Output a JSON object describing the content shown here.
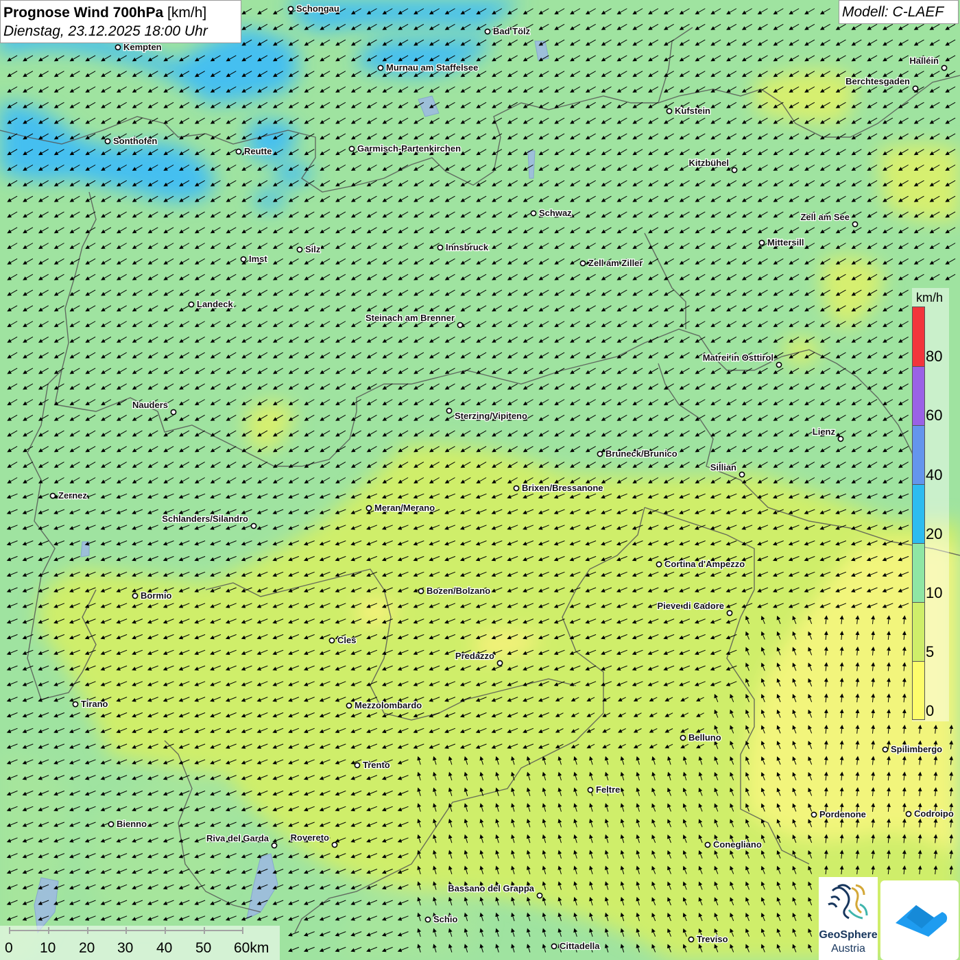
{
  "header": {
    "title_bold": "Prognose Wind 700hPa",
    "title_unit": "[km/h]",
    "datetime": "Dienstag, 23.12.2025 18:00 Uhr",
    "model": "Modell: C-LAEF"
  },
  "legend": {
    "unit": "km/h",
    "labels": [
      "80",
      "60",
      "40",
      "20",
      "10",
      "5",
      "0"
    ],
    "colors": {
      "80_plus": "#f2353b",
      "60_80": "#9a61e6",
      "40_60": "#6495ed",
      "20_40": "#2dbcf0",
      "10_20": "#8fe6a4",
      "5_10": "#cfee6a",
      "0_5": "#fdfc6c"
    }
  },
  "scale_bar": {
    "labels": [
      "0",
      "10",
      "20",
      "30",
      "40",
      "50",
      "60km"
    ]
  },
  "cities": [
    {
      "name": "Schongau"
    },
    {
      "name": "Bad Tölz"
    },
    {
      "name": "Kempten"
    },
    {
      "name": "Murnau am Staffelsee"
    },
    {
      "name": "Halléin"
    },
    {
      "name": "Berchtesgaden"
    },
    {
      "name": "Kufstein"
    },
    {
      "name": "Sonthofen"
    },
    {
      "name": "Reutte"
    },
    {
      "name": "Garmisch-Partenkirchen"
    },
    {
      "name": "Kitzbühel"
    },
    {
      "name": "Schwaz"
    },
    {
      "name": "Zell am See"
    },
    {
      "name": "Mittersill"
    },
    {
      "name": "Innsbruck"
    },
    {
      "name": "Silz"
    },
    {
      "name": "Imst"
    },
    {
      "name": "Zell am Ziller"
    },
    {
      "name": "Landeck"
    },
    {
      "name": "Steinach am Brenner"
    },
    {
      "name": "Matrei in Osttirol"
    },
    {
      "name": "Nauders"
    },
    {
      "name": "Sterzing/Vipiteno"
    },
    {
      "name": "Lienz"
    },
    {
      "name": "Bruneck/Brunico"
    },
    {
      "name": "Sillian"
    },
    {
      "name": "Zernez"
    },
    {
      "name": "Brixen/Bressanone"
    },
    {
      "name": "Meran/Merano"
    },
    {
      "name": "Schlanders/Silandro"
    },
    {
      "name": "Cortina d'Ampezzo"
    },
    {
      "name": "Bormio"
    },
    {
      "name": "Bozen/Bolzano"
    },
    {
      "name": "Pieve di Cadore"
    },
    {
      "name": "Cles"
    },
    {
      "name": "Predazzo"
    },
    {
      "name": "Tirano"
    },
    {
      "name": "Mezzolombardo"
    },
    {
      "name": "Belluno"
    },
    {
      "name": "Spilimbergo"
    },
    {
      "name": "Trento"
    },
    {
      "name": "Feltre"
    },
    {
      "name": "Pordenone"
    },
    {
      "name": "Codroipo"
    },
    {
      "name": "Bienno"
    },
    {
      "name": "Riva del Garda"
    },
    {
      "name": "Rovereto"
    },
    {
      "name": "Conegliano"
    },
    {
      "name": "Bassano del Grappa"
    },
    {
      "name": "Schio"
    },
    {
      "name": "Treviso"
    },
    {
      "name": "Cittadella"
    }
  ],
  "logos": {
    "geosphere_line1": "GeoSphere",
    "geosphere_line2": "Austria",
    "geosphere_icon": "geosphere-logo-icon",
    "app_icon": "wetter-app-icon"
  },
  "wind_field": {
    "dominant_direction": "from north-east",
    "south_east_direction": "from south"
  }
}
